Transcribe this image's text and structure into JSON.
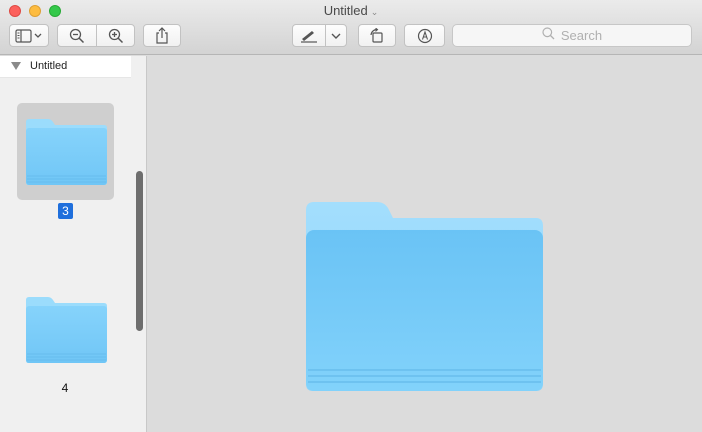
{
  "window": {
    "title": "Untitled",
    "title_chevron": "⌄"
  },
  "toolbar": {
    "buttons": [
      {
        "name": "sidebar-toggle",
        "icon": "sidebar-icon"
      },
      {
        "name": "zoom-out",
        "icon": "zoom-out-icon"
      },
      {
        "name": "zoom-in",
        "icon": "zoom-in-icon"
      },
      {
        "name": "share",
        "icon": "share-icon"
      },
      {
        "name": "markup-pen",
        "icon": "pen-icon"
      },
      {
        "name": "rotate",
        "icon": "rotate-icon"
      },
      {
        "name": "annotate",
        "icon": "markup-circle-icon"
      }
    ],
    "search_placeholder": "Search"
  },
  "sidebar": {
    "document_name": "Untitled",
    "pages": [
      {
        "label": "3",
        "selected": true
      },
      {
        "label": "4",
        "selected": false
      }
    ]
  },
  "colors": {
    "folder_light": "#8fd6fb",
    "folder_mid": "#6cc4f5",
    "selection": "#1f6fdc"
  }
}
